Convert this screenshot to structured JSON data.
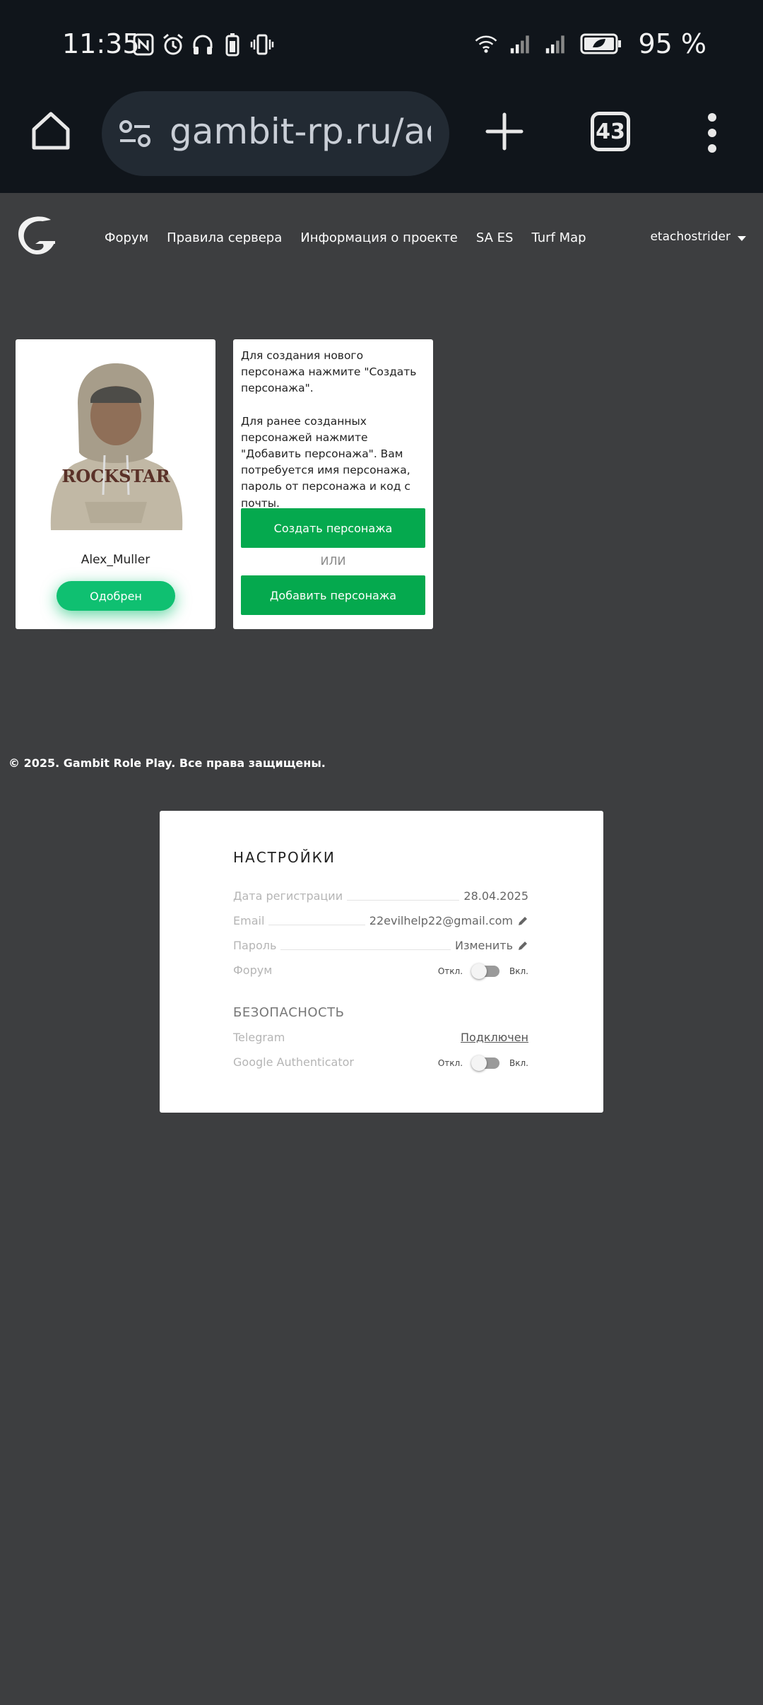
{
  "status_bar": {
    "time": "11:35",
    "battery_percent": "95 %",
    "icons_left": [
      "nfc-icon",
      "alarm-icon",
      "headphones-icon",
      "battery-saver-icon",
      "vibrate-icon"
    ],
    "icons_right": [
      "wifi-icon",
      "signal-icon",
      "signal-icon",
      "battery-icon"
    ]
  },
  "browser": {
    "url": "gambit-rp.ru/account",
    "tab_count": "43"
  },
  "nav": {
    "links": [
      "Форум",
      "Правила сервера",
      "Информация о проекте",
      "SA ES",
      "Turf Map"
    ],
    "username": "etachostrider"
  },
  "character": {
    "name": "Alex_Muller",
    "status_label": "Одобрен",
    "shirt_text": "ROCKSTAR"
  },
  "info": {
    "text1": "Для создания нового персонажа нажмите \"Создать персонажа\".",
    "text2": "Для ранее созданных персонажей нажмите \"Добавить персонажа\". Вам потребуется имя персонажа, пароль от персонажа и код с почты.",
    "create_label": "Создать персонажа",
    "or_label": "ИЛИ",
    "add_label": "Добавить персонажа"
  },
  "footer": {
    "text": "© 2025. Gambit Role Play. Все права защищены."
  },
  "settings": {
    "title": "НАСТРОЙКИ",
    "reg_date_label": "Дата регистрации",
    "reg_date_value": "28.04.2025",
    "email_label": "Email",
    "email_value": "22evilhelp22@gmail.com",
    "password_label": "Пароль",
    "password_value": "Изменить",
    "forum_label": "Форум",
    "off_label": "Откл.",
    "on_label": "Вкл.",
    "security_title": "БЕЗОПАСНОСТЬ",
    "telegram_label": "Telegram",
    "telegram_value": "Подключен",
    "ga_label": "Google Authenticator"
  },
  "colors": {
    "page_bg": "#3d3e40",
    "chrome_bg": "#10151b",
    "accent_green": "#05a94e",
    "approved_green": "#0fc071"
  }
}
